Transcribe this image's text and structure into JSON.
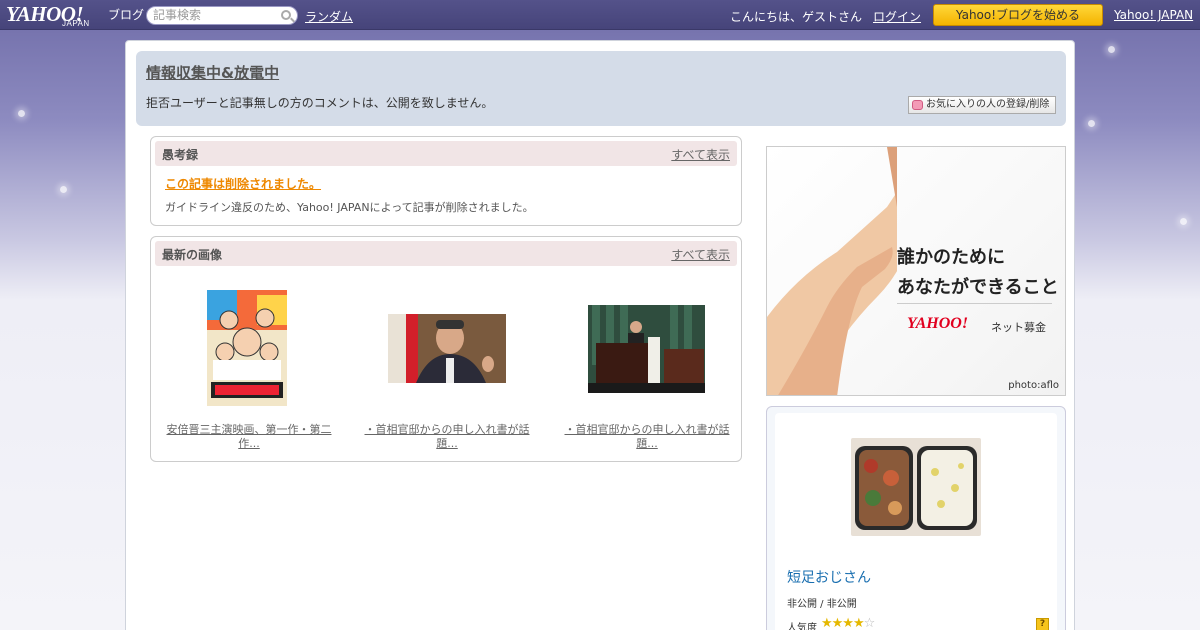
{
  "topbar": {
    "logo_text": "YAHOO!",
    "logo_japan": "JAPAN",
    "logo_blog": "ブログ",
    "search_placeholder": "記事検索",
    "random_label": "ランダム",
    "greeting": "こんにちは、ゲストさん",
    "login_label": "ログイン",
    "start_blog_label": "Yahoo!ブログを始める",
    "yahoo_japan_label": "Yahoo! JAPAN"
  },
  "blog_header": {
    "title": "情報収集中&放電中",
    "description": "拒否ユーザーと記事無しの方のコメントは、公開を致しません。",
    "favorite_button": "お気に入りの人の登録/削除"
  },
  "articles_panel": {
    "title": "愚考録",
    "more_label": "すべて表示",
    "deleted_title": "この記事は削除されました。",
    "deleted_note": "ガイドライン違反のため、Yahoo! JAPANによって記事が削除されました。"
  },
  "images_panel": {
    "title": "最新の画像",
    "more_label": "すべて表示",
    "items": [
      {
        "caption": "安倍晋三主演映画、第一作・第二作..."
      },
      {
        "caption": "・首相官邸からの申し入れ書が話題..."
      },
      {
        "caption": "・首相官邸からの申し入れ書が話題..."
      }
    ]
  },
  "ad": {
    "line1": "誰かのために",
    "line2": "あなたができること",
    "logo": "YAHOO!",
    "logo_sub": "ネット募金",
    "credit": "photo:aflo"
  },
  "profile": {
    "name": "短足おじさん",
    "status": "非公開 / 非公開",
    "popularity_label": "人気度",
    "stars_on": "★★★★",
    "stars_off": "☆",
    "help": "?"
  }
}
